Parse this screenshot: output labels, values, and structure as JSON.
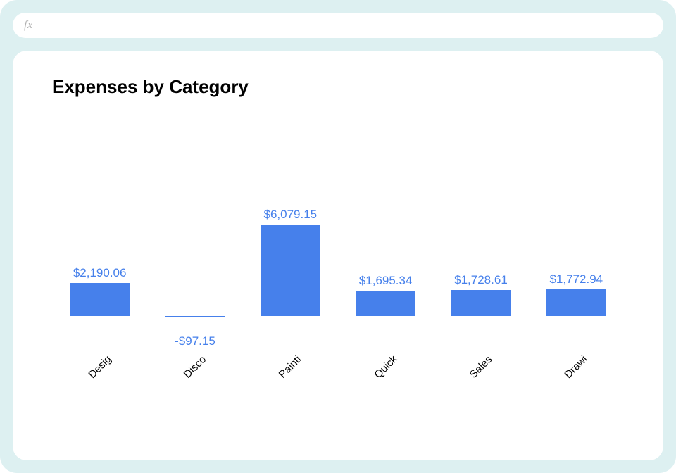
{
  "formula_bar": {
    "fx_label": "fx",
    "value": ""
  },
  "chart_data": {
    "type": "bar",
    "title": "Expenses by Category",
    "xlabel": "",
    "ylabel": "",
    "ylim": [
      -500,
      6500
    ],
    "categories": [
      "Desig",
      "Disco",
      "Painti",
      "Quick",
      "Sales",
      "Drawi"
    ],
    "values": [
      2190.06,
      -97.15,
      6079.15,
      1695.34,
      1728.61,
      1772.94
    ],
    "value_labels": [
      "$2,190.06",
      "-$97.15",
      "$6,079.15",
      "$1,695.34",
      "$1,728.61",
      "$1,772.94"
    ],
    "bar_color": "#4680eb",
    "label_color": "#4680eb"
  }
}
